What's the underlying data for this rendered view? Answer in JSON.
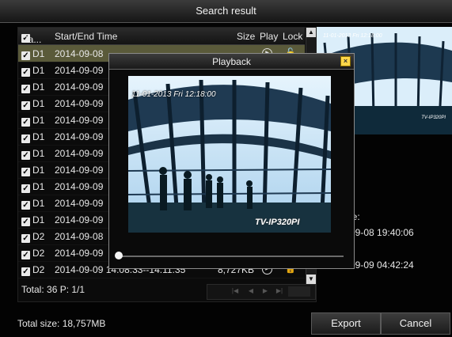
{
  "window": {
    "title": "Search result"
  },
  "list": {
    "headers": {
      "camera": "Ca...",
      "time": "Start/End Time",
      "size": "Size",
      "play": "Play",
      "lock": "Lock"
    },
    "rows": [
      {
        "camera": "D1",
        "time": "2014-09-08",
        "size": "",
        "selected": true
      },
      {
        "camera": "D1",
        "time": "2014-09-09",
        "size": ""
      },
      {
        "camera": "D1",
        "time": "2014-09-09",
        "size": ""
      },
      {
        "camera": "D1",
        "time": "2014-09-09",
        "size": ""
      },
      {
        "camera": "D1",
        "time": "2014-09-09",
        "size": ""
      },
      {
        "camera": "D1",
        "time": "2014-09-09",
        "size": ""
      },
      {
        "camera": "D1",
        "time": "2014-09-09",
        "size": ""
      },
      {
        "camera": "D1",
        "time": "2014-09-09",
        "size": ""
      },
      {
        "camera": "D1",
        "time": "2014-09-09",
        "size": ""
      },
      {
        "camera": "D1",
        "time": "2014-09-09",
        "size": ""
      },
      {
        "camera": "D1",
        "time": "2014-09-09",
        "size": ""
      },
      {
        "camera": "D2",
        "time": "2014-09-08",
        "size": ""
      },
      {
        "camera": "D2",
        "time": "2014-09-09",
        "size": ""
      },
      {
        "camera": "D2",
        "time": "2014-09-09 14:08:33--14:11:35",
        "size": "8,727KB"
      }
    ],
    "total": "Total: 36  P: 1/1"
  },
  "preview": {
    "osd": "11-01-2013 Fri 12:18:00",
    "watermark": "TV-IP320PI"
  },
  "info": {
    "start_label": "ne:",
    "start_value": "-09-08 19:40:06",
    "end_label": "e:",
    "end_value": "-09-09 04:42:24"
  },
  "footer": {
    "total_size": "Total size: 18,757MB",
    "export": "Export",
    "cancel": "Cancel"
  },
  "playback": {
    "title": "Playback",
    "osd": "11-01-2013 Fri 12:18:00",
    "watermark": "TV-IP320PI",
    "progress_fraction": 0
  },
  "icons": {
    "check": "checkbox-checked-icon",
    "play": "play-icon",
    "lock": "lock-icon",
    "close": "close-icon"
  },
  "colors": {
    "selected_row": "#5a5a3a",
    "close_button": "#ffd84a"
  }
}
